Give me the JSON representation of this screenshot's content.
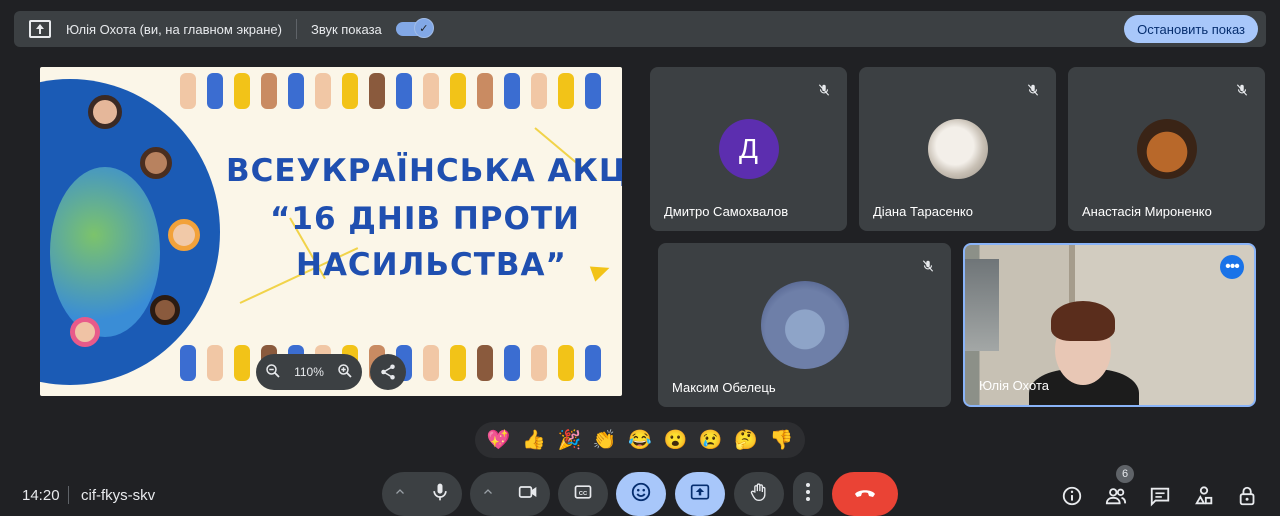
{
  "topbar": {
    "presenter": "Юлія Охота (ви, на главном экране)",
    "sound_label": "Звук показа",
    "sound_on": true,
    "stop_button": "Остановить показ"
  },
  "slide": {
    "title_line1": "ВСЕУКРАЇНСЬКА АКЦІЯ",
    "title_line2": "“16 ДНІВ ПРОТИ",
    "title_line3": "НАСИЛЬСТВА”",
    "zoom": "110%"
  },
  "participants": [
    {
      "name": "Дмитро Самохвалов",
      "initial": "Д",
      "muted": true
    },
    {
      "name": "Діана Тарасенко",
      "muted": true
    },
    {
      "name": "Анастасія Мироненко",
      "muted": true
    },
    {
      "name": "Максим Обелець",
      "muted": true
    },
    {
      "name": "Юлія Охота",
      "self": true
    }
  ],
  "reactions": [
    "💖",
    "👍",
    "🎉",
    "👏",
    "😂",
    "😮",
    "😢",
    "🤔",
    "👎"
  ],
  "meeting": {
    "time": "14:20",
    "code": "cif-fkys-skv",
    "participant_count": "6"
  },
  "colors": {
    "background": "#202124",
    "surface": "#3c4043",
    "accent": "#a8c7fa",
    "end_call": "#ea4335",
    "slide_blue": "#1f4fb0"
  },
  "icons": {
    "present": "present-to-all-icon",
    "mic": "mic-icon",
    "camera": "videocam-icon",
    "captions": "closed-caption-icon",
    "emoji": "emoji-icon",
    "present_now": "present-icon",
    "hand": "raise-hand-icon",
    "more": "more-vert-icon",
    "end": "call-end-icon",
    "info": "info-icon",
    "people": "people-icon",
    "chat": "chat-icon",
    "activities": "activities-icon",
    "host": "host-controls-icon"
  }
}
